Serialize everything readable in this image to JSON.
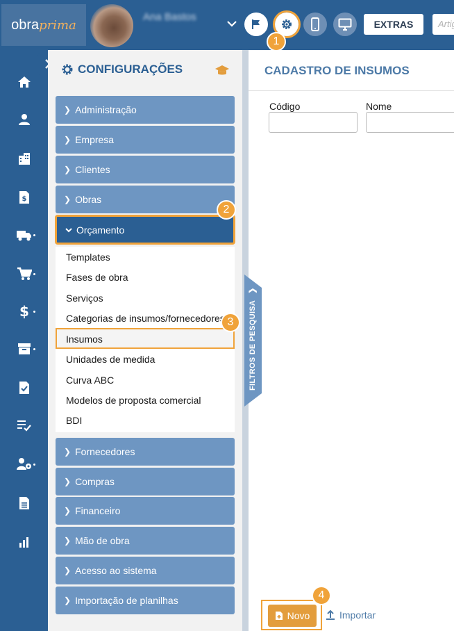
{
  "header": {
    "logo_text_a": "obra",
    "logo_text_b": "prima",
    "user_name": "Ana Bastos",
    "extras_label": "EXTRAS",
    "search_placeholder": "Artigos"
  },
  "iconbar": {
    "icons": [
      "home-icon",
      "user-icon",
      "building-icon",
      "invoice-icon",
      "truck-icon",
      "cart-icon",
      "dollar-icon",
      "archive-icon",
      "checked-doc-icon",
      "checklist-icon",
      "users-gear-icon",
      "document-icon",
      "bar-chart-icon"
    ]
  },
  "config": {
    "title": "CONFIGURAÇÕES",
    "menu_top": [
      {
        "label": "Administração"
      },
      {
        "label": "Empresa"
      },
      {
        "label": "Clientes"
      },
      {
        "label": "Obras"
      }
    ],
    "active_menu": {
      "label": "Orçamento"
    },
    "submenu": [
      {
        "label": "Templates"
      },
      {
        "label": "Fases de obra"
      },
      {
        "label": "Serviços"
      },
      {
        "label": "Categorias de insumos/fornecedores"
      },
      {
        "label": "Insumos"
      },
      {
        "label": "Unidades de medida"
      },
      {
        "label": "Curva ABC"
      },
      {
        "label": "Modelos de proposta comercial"
      },
      {
        "label": "BDI"
      }
    ],
    "menu_bottom": [
      {
        "label": "Fornecedores"
      },
      {
        "label": "Compras"
      },
      {
        "label": "Financeiro"
      },
      {
        "label": "Mão de obra"
      },
      {
        "label": "Acesso ao sistema"
      },
      {
        "label": "Importação de planilhas"
      }
    ]
  },
  "filter_tab_label": "FILTROS DE PESQUISA",
  "main": {
    "title": "CADASTRO DE INSUMOS",
    "field_codigo_label": "Código",
    "field_nome_label": "Nome",
    "novo_label": "Novo",
    "importar_label": "Importar"
  },
  "steps": [
    "1",
    "2",
    "3",
    "4"
  ],
  "colors": {
    "primary": "#2b5f93",
    "menu": "#6e96c2",
    "accent": "#f0a33a"
  }
}
